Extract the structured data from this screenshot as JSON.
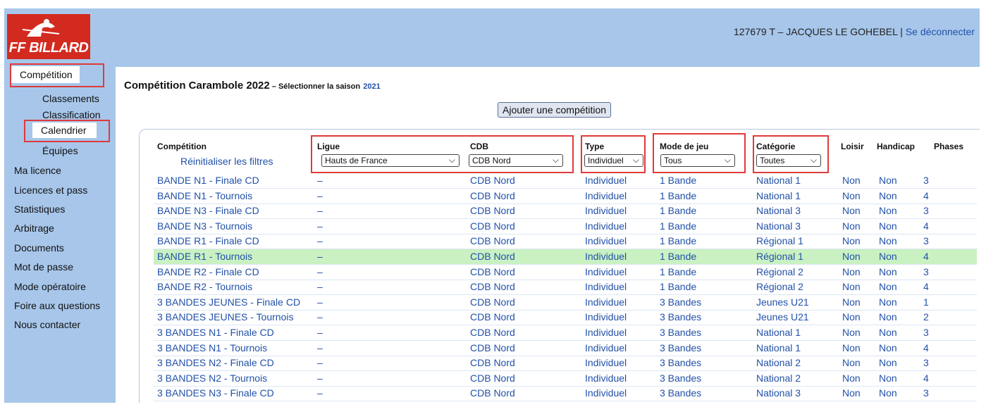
{
  "brand": {
    "logo_text": "FF BILLARD",
    "color": "#d32a1f"
  },
  "header": {
    "user": "127679 T – JACQUES LE GOHEBEL",
    "separator": " | ",
    "logout": "Se déconnecter"
  },
  "sidebar": {
    "items": [
      {
        "label": "Compétition"
      },
      {
        "label": "Classements"
      },
      {
        "label": "Classification"
      },
      {
        "label": "Calendrier"
      },
      {
        "label": "Équipes"
      },
      {
        "label": "Ma licence"
      },
      {
        "label": "Licences et pass"
      },
      {
        "label": "Statistiques"
      },
      {
        "label": "Arbitrage"
      },
      {
        "label": "Documents"
      },
      {
        "label": "Mot de passe"
      },
      {
        "label": "Mode opératoire"
      },
      {
        "label": "Foire aux questions"
      },
      {
        "label": "Nous contacter"
      }
    ]
  },
  "main": {
    "title": "Compétition Carambole 2022",
    "title_sep": " – ",
    "season_prompt": "Sélectionner la saison",
    "season": "2021",
    "add_button": "Ajouter une compétition"
  },
  "table": {
    "headers": [
      "Compétition",
      "Ligue",
      "CDB",
      "Type",
      "Mode de jeu",
      "Catégorie",
      "Loisir",
      "Handicap",
      "Phases"
    ],
    "reset_filters": "Réinitialiser les filtres",
    "filters": {
      "ligue": "Hauts de France",
      "cdb": "CDB Nord",
      "type": "Individuel",
      "mode": "Tous",
      "categorie": "Toutes"
    },
    "rows": [
      [
        "BANDE N1 - Finale CD",
        "–",
        "CDB Nord",
        "Individuel",
        "1 Bande",
        "National 1",
        "Non",
        "Non",
        "3"
      ],
      [
        "BANDE N1 - Tournois",
        "–",
        "CDB Nord",
        "Individuel",
        "1 Bande",
        "National 1",
        "Non",
        "Non",
        "4"
      ],
      [
        "BANDE N3 - Finale CD",
        "–",
        "CDB Nord",
        "Individuel",
        "1 Bande",
        "National 3",
        "Non",
        "Non",
        "3"
      ],
      [
        "BANDE N3 - Tournois",
        "–",
        "CDB Nord",
        "Individuel",
        "1 Bande",
        "National 3",
        "Non",
        "Non",
        "4"
      ],
      [
        "BANDE R1 - Finale CD",
        "–",
        "CDB Nord",
        "Individuel",
        "1 Bande",
        "Régional 1",
        "Non",
        "Non",
        "3"
      ],
      [
        "BANDE R1 - Tournois",
        "–",
        "CDB Nord",
        "Individuel",
        "1 Bande",
        "Régional 1",
        "Non",
        "Non",
        "4"
      ],
      [
        "BANDE R2 - Finale CD",
        "–",
        "CDB Nord",
        "Individuel",
        "1 Bande",
        "Régional 2",
        "Non",
        "Non",
        "3"
      ],
      [
        "BANDE R2 - Tournois",
        "–",
        "CDB Nord",
        "Individuel",
        "1 Bande",
        "Régional 2",
        "Non",
        "Non",
        "4"
      ],
      [
        "3 BANDES JEUNES - Finale CD",
        "–",
        "CDB Nord",
        "Individuel",
        "3 Bandes",
        "Jeunes U21",
        "Non",
        "Non",
        "1"
      ],
      [
        "3 BANDES JEUNES - Tournois",
        "–",
        "CDB Nord",
        "Individuel",
        "3 Bandes",
        "Jeunes U21",
        "Non",
        "Non",
        "2"
      ],
      [
        "3 BANDES N1 - Finale CD",
        "–",
        "CDB Nord",
        "Individuel",
        "3 Bandes",
        "National 1",
        "Non",
        "Non",
        "3"
      ],
      [
        "3 BANDES N1 - Tournois",
        "–",
        "CDB Nord",
        "Individuel",
        "3 Bandes",
        "National 1",
        "Non",
        "Non",
        "4"
      ],
      [
        "3 BANDES N2 - Finale CD",
        "–",
        "CDB Nord",
        "Individuel",
        "3 Bandes",
        "National 2",
        "Non",
        "Non",
        "3"
      ],
      [
        "3 BANDES N2 - Tournois",
        "–",
        "CDB Nord",
        "Individuel",
        "3 Bandes",
        "National 2",
        "Non",
        "Non",
        "4"
      ],
      [
        "3 BANDES N3 - Finale CD",
        "–",
        "CDB Nord",
        "Individuel",
        "3 Bandes",
        "National 3",
        "Non",
        "Non",
        "3"
      ]
    ],
    "highlighted_row": 5
  },
  "colors": {
    "link": "#2251a8",
    "highlight_row": "#c9f1c2",
    "annotation_box": "#e03a3a",
    "frame": "#a7c6ea"
  }
}
